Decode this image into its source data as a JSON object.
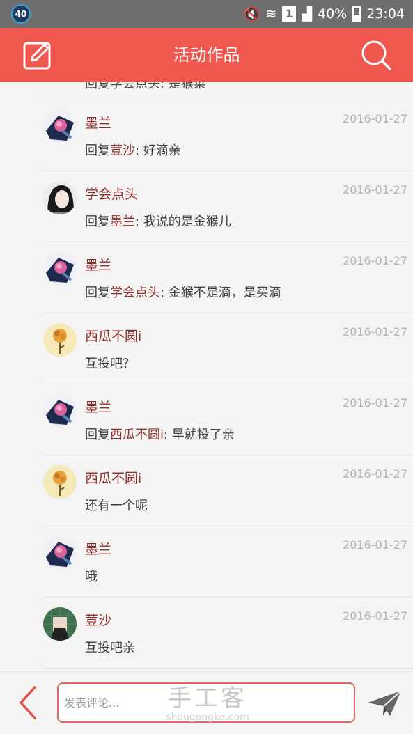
{
  "status_bar": {
    "badge": "40",
    "sim": "1",
    "battery": "40%",
    "time": "23:04"
  },
  "header": {
    "title": "活动作品",
    "edit_icon": "edit-icon",
    "search_icon": "search-icon"
  },
  "partial_item": {
    "text": "回复学会点头: 是猴菜"
  },
  "comments": [
    {
      "user": "墨兰",
      "date": "2016-01-27",
      "reply_prefix": "回复",
      "reply_to": "荳沙",
      "text": ": 好滴亲",
      "avatar": "rose"
    },
    {
      "user": "学会点头",
      "date": "2016-01-27",
      "reply_prefix": "回复",
      "reply_to": "墨兰",
      "text": ": 我说的是金猴儿",
      "avatar": "girl"
    },
    {
      "user": "墨兰",
      "date": "2016-01-27",
      "reply_prefix": "回复",
      "reply_to": "学会点头",
      "text": ": 金猴不是滴，是买滴",
      "avatar": "rose"
    },
    {
      "user": "西瓜不圆i",
      "date": "2016-01-27",
      "reply_prefix": "",
      "reply_to": "",
      "text": "互投吧？",
      "avatar": "flower"
    },
    {
      "user": "墨兰",
      "date": "2016-01-27",
      "reply_prefix": "回复",
      "reply_to": "西瓜不圆i",
      "text": ": 早就投了亲",
      "avatar": "rose"
    },
    {
      "user": "西瓜不圆i",
      "date": "2016-01-27",
      "reply_prefix": "",
      "reply_to": "",
      "text": "还有一个呢",
      "avatar": "flower"
    },
    {
      "user": "墨兰",
      "date": "2016-01-27",
      "reply_prefix": "",
      "reply_to": "",
      "text": "哦",
      "avatar": "rose"
    },
    {
      "user": "荳沙",
      "date": "2016-01-27",
      "reply_prefix": "",
      "reply_to": "",
      "text": "互投吧亲",
      "avatar": "green"
    }
  ],
  "bottom_bar": {
    "placeholder": "发表评论...",
    "watermark": "手工客",
    "watermark_sub": "shougongke.com",
    "back_icon": "chevron-left-icon",
    "send_icon": "send-icon"
  },
  "colors": {
    "accent": "#f0574e",
    "username": "#8c2e2a",
    "date": "#b3b3b3"
  }
}
